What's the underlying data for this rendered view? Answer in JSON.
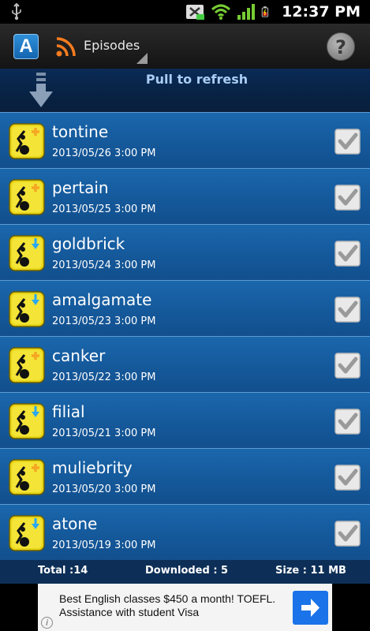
{
  "status_bar": {
    "time": "12:37 PM",
    "icons": [
      "usb-icon",
      "sync-icon",
      "wifi-icon",
      "signal-icon",
      "battery-icon"
    ]
  },
  "action_bar": {
    "logo_letter": "A",
    "feed_icon": "rss-icon",
    "spinner_label": "Episodes",
    "help_label": "?"
  },
  "pull_refresh": {
    "label": "Pull to refresh"
  },
  "episodes": [
    {
      "title": "tontine",
      "date": "2013/05/26 3:00 PM",
      "status": "new",
      "checked": true
    },
    {
      "title": "pertain",
      "date": "2013/05/25 3:00 PM",
      "status": "new",
      "checked": true
    },
    {
      "title": "goldbrick",
      "date": "2013/05/24 3:00 PM",
      "status": "downloaded",
      "checked": true
    },
    {
      "title": "amalgamate",
      "date": "2013/05/23 3:00 PM",
      "status": "downloaded",
      "checked": true
    },
    {
      "title": "canker",
      "date": "2013/05/22 3:00 PM",
      "status": "new",
      "checked": true
    },
    {
      "title": "filial",
      "date": "2013/05/21 3:00 PM",
      "status": "downloaded",
      "checked": true
    },
    {
      "title": "muliebrity",
      "date": "2013/05/20 3:00 PM",
      "status": "new",
      "checked": true
    },
    {
      "title": "atone",
      "date": "2013/05/19 3:00 PM",
      "status": "downloaded",
      "checked": true
    }
  ],
  "footer": {
    "total": "Total :14",
    "downloaded": "Downloded : 5",
    "size": "Size : 11 MB"
  },
  "ad": {
    "text": "Best English classes $450 a month! TOEFL. Assistance with student Visa",
    "info_label": "i"
  },
  "colors": {
    "list_background": "#155a9c",
    "header_background": "#072243",
    "footer_background": "#0d2f57",
    "accent_plus": "#f5a623",
    "accent_download": "#2aa8f0",
    "ad_button": "#1a73e8"
  }
}
